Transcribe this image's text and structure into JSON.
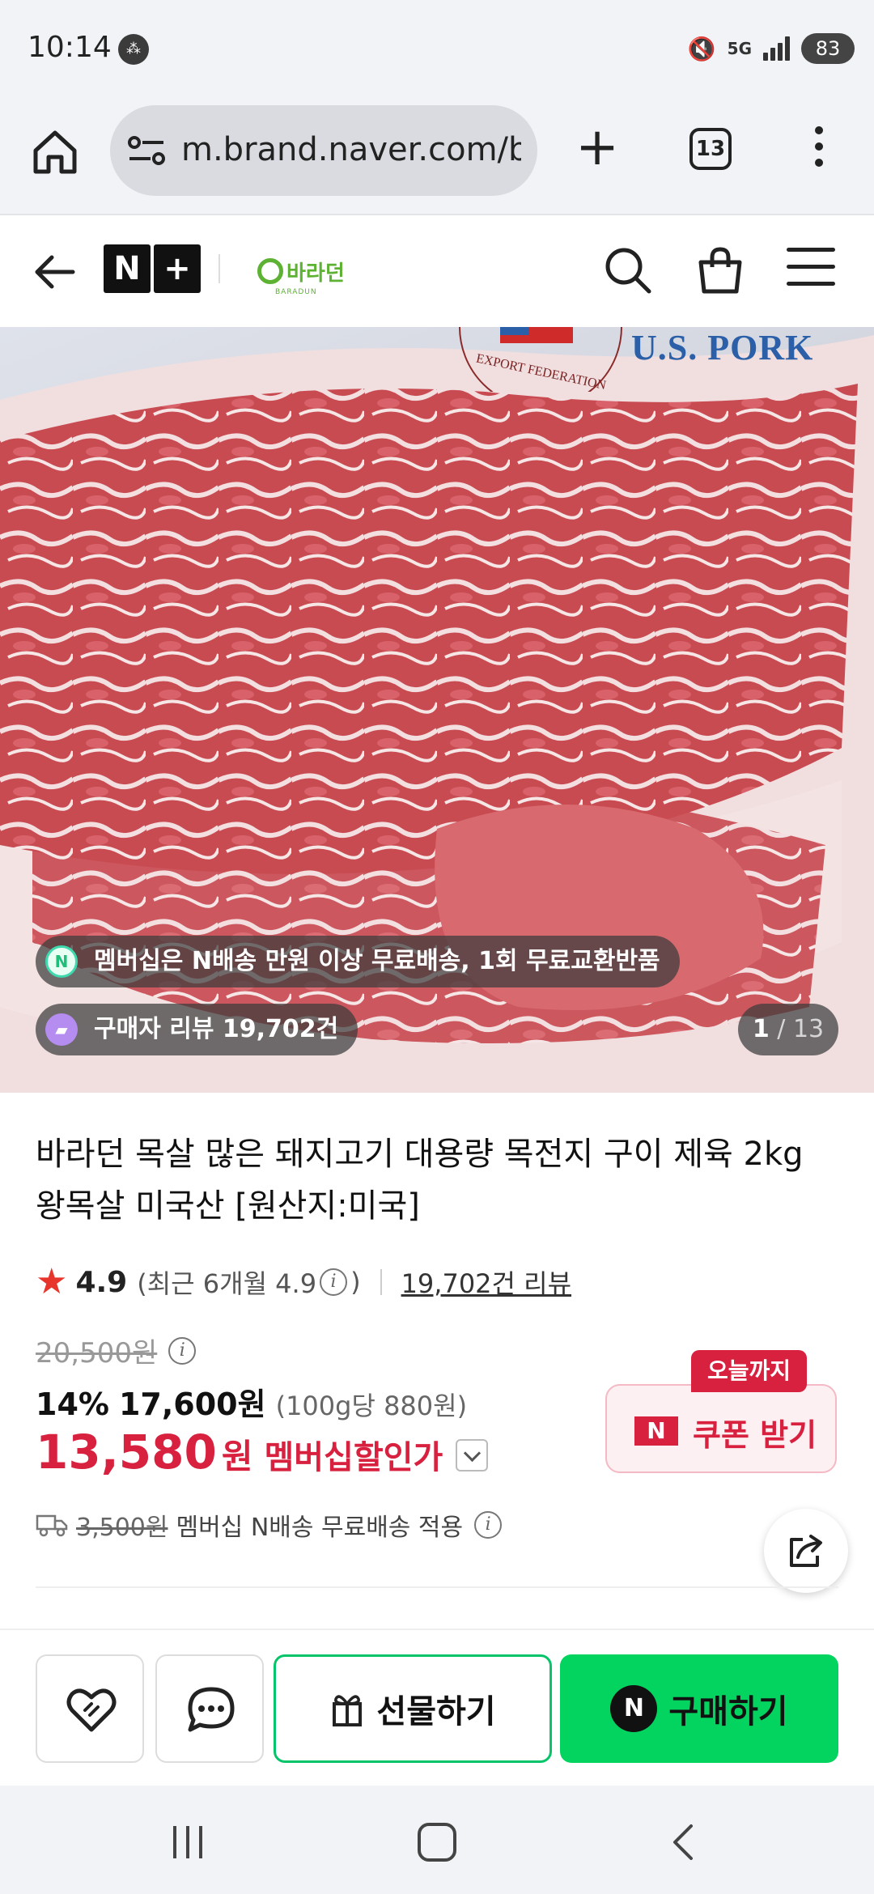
{
  "status_bar": {
    "time": "10:14",
    "network": "5G",
    "battery": "83"
  },
  "browser": {
    "url": "m.brand.naver.com/b",
    "tab_count": "13"
  },
  "header": {
    "logo": "N+",
    "brand_name": "바라던",
    "brand_sub": "BARADUN"
  },
  "hero": {
    "logo_text": "U.S. PORK",
    "seal_text": "EXPORT FEDERATION",
    "membership_badge": "멤버십은 N배송 만원 이상 무료배송, 1회 무료교환반품",
    "review_badge": "구매자 리뷰 19,702건",
    "page_current": "1",
    "page_total": "13"
  },
  "product": {
    "title": "바라던 목살 많은 돼지고기 대용량 목전지 구이 제육 2kg 왕목살 미국산 [원산지:미국]",
    "rating": "4.9",
    "rating_recent": "(최근 6개월 4.9",
    "rating_recent_close": ")",
    "review_count": "19,702건 리뷰",
    "original_price": "20,500원",
    "discount": "14%",
    "sale_price": "17,600원",
    "unit_price": "(100g당 880원)",
    "member_price": "13,580",
    "member_won": "원",
    "member_label": "멤버십할인가",
    "shipping_old": "3,500원",
    "shipping_text": "멤버십 N배송 무료배송 적용"
  },
  "coupon": {
    "tag": "오늘까지",
    "n": "N",
    "label": "쿠폰 받기"
  },
  "actions": {
    "gift_label": "선물하기",
    "buy_n": "N",
    "buy_label": "구매하기"
  },
  "colors": {
    "accent_red": "#d8203f",
    "naver_green": "#03d45f",
    "brand_green": "#5db233"
  }
}
